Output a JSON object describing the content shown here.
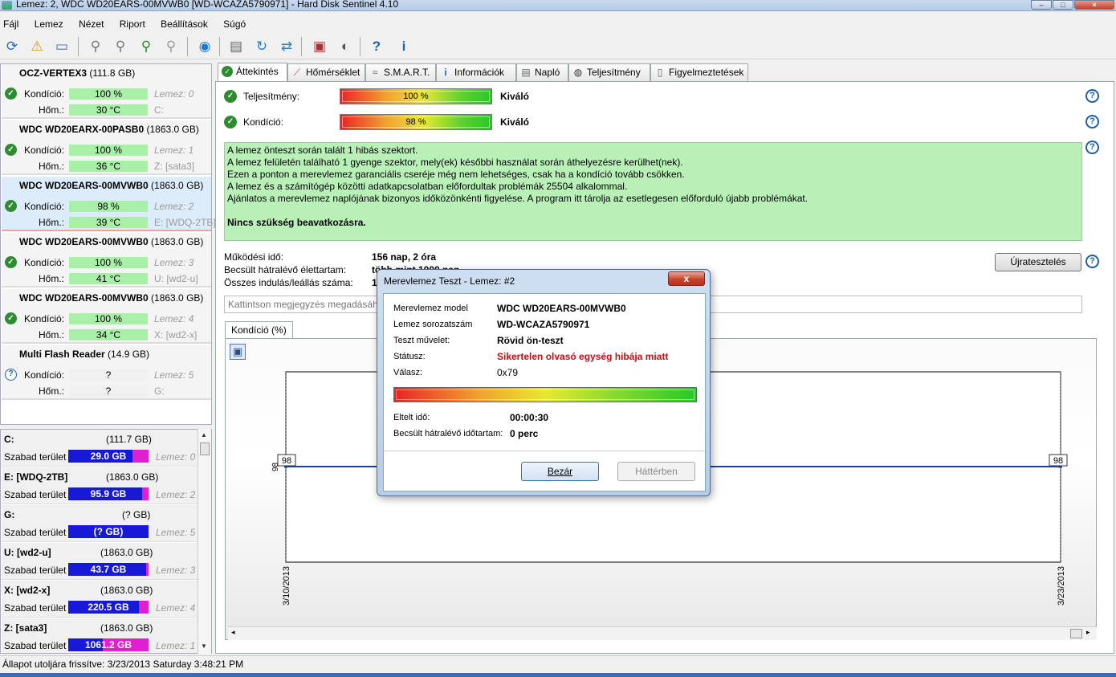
{
  "window": {
    "title": "Lemez: 2, WDC WD20EARS-00MVWB0 [WD-WCAZA5790971]  -  Hard Disk Sentinel 4.10"
  },
  "menu": [
    "Fájl",
    "Lemez",
    "Nézet",
    "Riport",
    "Beállítások",
    "Súgó"
  ],
  "toolbar": {
    "icons": [
      "refresh-icon",
      "warning-icon",
      "disk-icon",
      "satellite-icon",
      "satellite-warn-icon",
      "satellite-ok-icon",
      "satellite-off-icon",
      "globe-icon",
      "report-icon",
      "refresh-2-icon",
      "network-icon",
      "settings-icon",
      "sound-icon",
      "help-icon",
      "info-icon"
    ]
  },
  "disks": [
    {
      "name": "OCZ-VERTEX3",
      "size": "(111.8 GB)",
      "cond_label": "Kondíció:",
      "cond": "100 %",
      "cond_aux": "Lemez: 0",
      "temp_label": "Hőm.:",
      "temp": "30 °C",
      "temp_aux": "C:"
    },
    {
      "name": "WDC WD20EARX-00PASB0",
      "size": "(1863.0 GB)",
      "cond_label": "Kondíció:",
      "cond": "100 %",
      "cond_aux": "Lemez: 1",
      "temp_label": "Hőm.:",
      "temp": "36 °C",
      "temp_aux": "Z: [sata3]"
    },
    {
      "name": "WDC WD20EARS-00MVWB0",
      "size": "(1863.0 GB)",
      "cond_label": "Kondíció:",
      "cond": "98 %",
      "cond_aux": "Lemez: 2",
      "temp_label": "Hőm.:",
      "temp": "39 °C",
      "temp_aux": "E: [WDQ-2TB]"
    },
    {
      "name": "WDC WD20EARS-00MVWB0",
      "size": "(1863.0 GB)",
      "cond_label": "Kondíció:",
      "cond": "100 %",
      "cond_aux": "Lemez: 3",
      "temp_label": "Hőm.:",
      "temp": "41 °C",
      "temp_aux": "U: [wd2-u]"
    },
    {
      "name": "WDC WD20EARS-00MVWB0",
      "size": "(1863.0 GB)",
      "cond_label": "Kondíció:",
      "cond": "100 %",
      "cond_aux": "Lemez: 4",
      "temp_label": "Hőm.:",
      "temp": "34 °C",
      "temp_aux": "X: [wd2-x]"
    },
    {
      "name": "Multi  Flash Reader",
      "size": "(14.9 GB)",
      "cond_label": "Kondíció:",
      "cond": "?",
      "cond_aux": "Lemez: 5",
      "temp_label": "Hőm.:",
      "temp": "?",
      "temp_aux": "G:"
    }
  ],
  "volumes": [
    {
      "name": "C:",
      "size": "(111.7 GB)",
      "free_label": "Szabad terület",
      "free": "29.0 GB",
      "disk": "Lemez: 0"
    },
    {
      "name": "E: [WDQ-2TB]",
      "size": "(1863.0 GB)",
      "free_label": "Szabad terület",
      "free": "95.9 GB",
      "disk": "Lemez: 2"
    },
    {
      "name": "G:",
      "size": "(? GB)",
      "free_label": "Szabad terület",
      "free": "(? GB)",
      "disk": "Lemez: 5"
    },
    {
      "name": "U: [wd2-u]",
      "size": "(1863.0 GB)",
      "free_label": "Szabad terület",
      "free": "43.7 GB",
      "disk": "Lemez: 3"
    },
    {
      "name": "X: [wd2-x]",
      "size": "(1863.0 GB)",
      "free_label": "Szabad terület",
      "free": "220.5 GB",
      "disk": "Lemez: 4"
    },
    {
      "name": "Z: [sata3]",
      "size": "(1863.0 GB)",
      "free_label": "Szabad terület",
      "free": "1061.2 GB",
      "disk": "Lemez: 1"
    }
  ],
  "tabs": [
    "Áttekintés",
    "Hőmérséklet",
    "S.M.A.R.T.",
    "Információk",
    "Napló",
    "Teljesítmény",
    "Figyelmeztetések"
  ],
  "overview": {
    "perf_label": "Teljesítmény:",
    "perf_value": "100 %",
    "perf_rating": "Kiváló",
    "cond_label": "Kondíció:",
    "cond_value": "98 %",
    "cond_rating": "Kiváló",
    "message_lines": [
      "A lemez önteszt során talált 1 hibás szektort.",
      "A lemez felületén található 1 gyenge szektor, mely(ek) későbbi használat során áthelyezésre kerülhet(nek).",
      "Ezen a ponton a merevlemez garanciális cseréje még nem lehetséges, csak ha a kondíció tovább csökken.",
      "A lemez és a számítógép közötti adatkapcsolatban előfordultak problémák 25504 alkalommal.",
      "Ajánlatos a merevlemez naplójának bizonyos időközönkénti figyelése. A program itt tárolja az esetlegesen előforduló újabb problémákat."
    ],
    "message_bold": "Nincs szükség beavatkozásra.",
    "uptime_label": "Működési idő:",
    "uptime": "156 nap, 2 óra",
    "life_label": "Becsült hátralévő élettartam:",
    "life": "több mint 1000 nap",
    "starts_label": "Összes indulás/leállás száma:",
    "starts": "1",
    "retest": "Újratesztelés",
    "note_placeholder": "Kattintson megjegyzés megadásához"
  },
  "chart_tab": "Kondíció  (%)",
  "chart_data": {
    "type": "line",
    "x": [
      "3/10/2013",
      "3/23/2013"
    ],
    "series": [
      {
        "values": [
          98,
          98
        ]
      }
    ],
    "data_labels": [
      "98",
      "98"
    ],
    "axis_label": "98"
  },
  "dialog": {
    "title": "Merevlemez Teszt - Lemez: #2",
    "close": "x",
    "model_label": "Merevlemez model",
    "model": "WDC WD20EARS-00MVWB0",
    "serial_label": "Lemez sorozatszám",
    "serial": "WD-WCAZA5790971",
    "op_label": "Teszt művelet:",
    "op": "Rövid ön-teszt",
    "status_label": "Státusz:",
    "status": "Sikertelen olvasó egység hibája miatt",
    "resp_label": "Válasz:",
    "resp": "0x79",
    "progress": 1.0,
    "elapsed_label": "Eltelt idő:",
    "elapsed": "00:00:30",
    "remaining_label": "Becsült hátralévő időtartam:",
    "remaining": "0 perc",
    "btn_close": "Bezár",
    "btn_bg": "Háttérben"
  },
  "statusbar": "Állapot utoljára frissítve: 3/23/2013 Saturday 3:48:21 PM"
}
